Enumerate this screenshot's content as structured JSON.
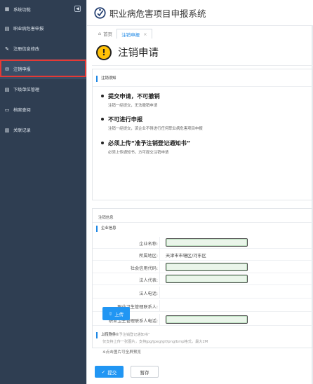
{
  "sidebar": {
    "items": [
      {
        "label": "系统功能",
        "icon": "grid-icon"
      },
      {
        "label": "职业病危害申报",
        "icon": "document-icon"
      },
      {
        "label": "注册信息修改",
        "icon": "edit-icon"
      },
      {
        "label": "注销申报",
        "icon": "mail-icon"
      },
      {
        "label": "下级单位管理",
        "icon": "document-icon"
      },
      {
        "label": "档案查阅",
        "icon": "archive-icon"
      },
      {
        "label": "关联记录",
        "icon": "chart-icon"
      }
    ],
    "toggle_symbol": "◀"
  },
  "header": {
    "system_title": "职业病危害项目申报系统"
  },
  "tabs": [
    {
      "label": "首页",
      "icon": "home-icon"
    },
    {
      "label": "注销申报",
      "close": "×"
    }
  ],
  "page": {
    "title": "注销申请",
    "warn_symbol": "!"
  },
  "notice": {
    "section_label": "注销须知",
    "items": [
      {
        "title": "提交申请，不可撤销",
        "desc": "注销一经提交，无法撤销申请"
      },
      {
        "title": "不可进行申报",
        "desc": "注销一经提交，该企业不得进行任何职业病危害项目申报"
      },
      {
        "title": "必须上传“准予注销登记通知书”",
        "desc": "必须上传通知书，方可提交注销申请"
      }
    ]
  },
  "info": {
    "caption": "注销信息",
    "company_section": "企业信息",
    "fields": [
      {
        "label": "企业名称:",
        "value": "",
        "type": "input"
      },
      {
        "label": "所属地区:",
        "value": "天津市市辖区/河东区",
        "type": "text"
      },
      {
        "label": "社会信用代码:",
        "value": "",
        "type": "input"
      },
      {
        "label": "法人代表:",
        "value": "",
        "type": "input"
      },
      {
        "label": "法人电话:",
        "value": "",
        "type": "text"
      },
      {
        "label": "职业卫生管理联系人:",
        "value": "",
        "type": "text"
      },
      {
        "label": "职业卫生管理联系人电话:",
        "value": "",
        "type": "input"
      }
    ],
    "attach_section": "上传附件"
  },
  "upload": {
    "label": "上传",
    "hint1": "请上传“准予注销登记通知书”",
    "hint2": "仅支持上传一张图片，支持jpg/jpeg/gif/png/bmp格式，最大2M",
    "hint3": "※点击图片可全屏预览"
  },
  "actions": {
    "submit": "提交",
    "save": "暂存"
  }
}
